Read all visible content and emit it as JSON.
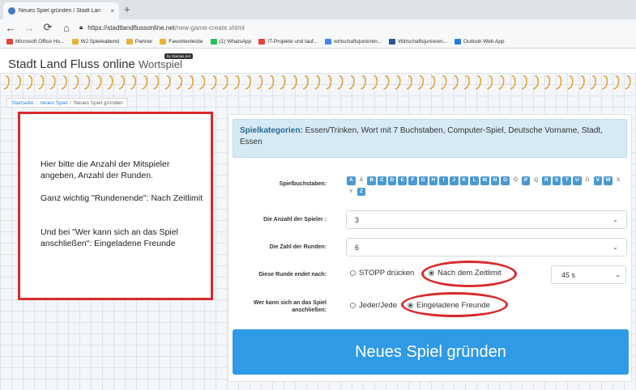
{
  "browser": {
    "tab_title": "Neues Spiel gründen / Stadt Lan",
    "tab_close": "×",
    "new_tab": "+",
    "url_host": "https://stadtlandflussonline.net",
    "url_path": "/new-game-create.xhtml",
    "bookmarks": [
      {
        "label": "Microsoft Office Ho...",
        "color": "#e0453a"
      },
      {
        "label": "WJ Spieleabend",
        "color": "#e8b43a"
      },
      {
        "label": "Partner",
        "color": "#e8b43a"
      },
      {
        "label": "Favoritenleiste",
        "color": "#e8b43a"
      },
      {
        "label": "(1) WhatsApp",
        "color": "#2bbf5a"
      },
      {
        "label": "IT-Projekte und lauf...",
        "color": "#e0453a"
      },
      {
        "label": "wirtschaftsjunioren...",
        "color": "#4285f4"
      },
      {
        "label": "Wirtschaftsjunioren...",
        "color": "#2b579a"
      },
      {
        "label": "Outlook Web App",
        "color": "#2b7cd3"
      }
    ]
  },
  "site": {
    "brand_main": "Stadt Land Fluss online",
    "brand_sub": "Wortspiel",
    "byline": "by Gamias.net"
  },
  "breadcrumb": {
    "home": "Startseite",
    "new_game": "neues Spiel",
    "current": "Neues Spiel gründen"
  },
  "note": {
    "p1": "Hier bitte die Anzahl der Mitspieler angeben, Anzahl der Runden.",
    "p2": "Ganz wichtig \"Rundenende\": Nach Zeitlimit",
    "p3": "Und bei \"Wer kann sich an das Spiel anschließen\": Eingeladene Freunde"
  },
  "categories": {
    "label": "Spielkategorien:",
    "value": "Essen/Trinken, Wort mit 7 Buchstaben, Computer-Spiel, Deutsche Vorname, Stadt, Essen"
  },
  "form": {
    "letters_label": "Spielbuchstaben:",
    "letters": [
      {
        "ch": "A",
        "on": true
      },
      {
        "ch": "Ä",
        "on": false
      },
      {
        "ch": "B",
        "on": true
      },
      {
        "ch": "C",
        "on": true
      },
      {
        "ch": "D",
        "on": true
      },
      {
        "ch": "E",
        "on": true
      },
      {
        "ch": "F",
        "on": true
      },
      {
        "ch": "G",
        "on": true
      },
      {
        "ch": "H",
        "on": true
      },
      {
        "ch": "I",
        "on": true
      },
      {
        "ch": "J",
        "on": true
      },
      {
        "ch": "K",
        "on": true
      },
      {
        "ch": "L",
        "on": true
      },
      {
        "ch": "M",
        "on": true
      },
      {
        "ch": "N",
        "on": true
      },
      {
        "ch": "O",
        "on": true
      },
      {
        "ch": "Ö",
        "on": false
      },
      {
        "ch": "P",
        "on": true
      },
      {
        "ch": "Q",
        "on": false
      },
      {
        "ch": "R",
        "on": true
      },
      {
        "ch": "S",
        "on": true
      },
      {
        "ch": "T",
        "on": true
      },
      {
        "ch": "U",
        "on": true
      },
      {
        "ch": "Ü",
        "on": false
      },
      {
        "ch": "V",
        "on": true
      },
      {
        "ch": "W",
        "on": true
      },
      {
        "ch": "X",
        "on": false
      },
      {
        "ch": "Y",
        "on": false
      },
      {
        "ch": "Z",
        "on": true
      }
    ],
    "players_label": "Die Anzahl der Spieler :",
    "players_value": "3",
    "rounds_label": "Die Zahl der Runden:",
    "rounds_value": "6",
    "round_end_label": "Diese Runde endet nach:",
    "round_end_opt1": "STOPP drücken",
    "round_end_opt2": "Nach dem Zeitlimit",
    "time_value": "45 s",
    "join_label": "Wer kann sich an das Spiel anschließen:",
    "join_opt1": "Jeder/Jede",
    "join_opt2": "Eingeladene Freunde",
    "create_button": "Neues Spiel gründen"
  },
  "colors": {
    "accent": "#2f9ae6",
    "highlight_ring": "#d82a2a",
    "letter_on": "#4b98d0"
  }
}
